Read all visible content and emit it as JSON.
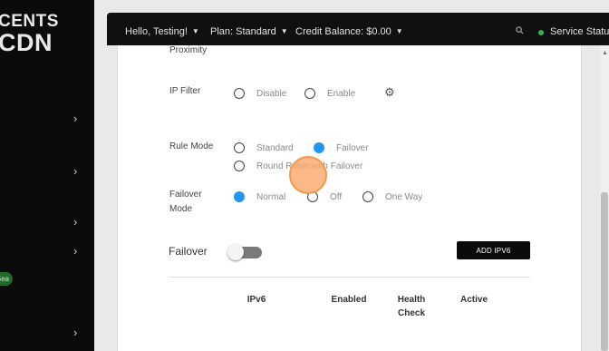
{
  "brand": {
    "line1": "CENTS",
    "line2": "CDN"
  },
  "sidebar": {
    "badge": "Sea"
  },
  "topbar": {
    "greeting": "Hello, Testing!",
    "plan": "Plan: Standard",
    "credit": "Credit Balance: $0.00",
    "service_status": "Service Status"
  },
  "form": {
    "proximity_label": "Proximity",
    "ip_filter": {
      "label": "IP Filter",
      "options": [
        "Disable",
        "Enable"
      ],
      "selected": ""
    },
    "rule_mode": {
      "label": "Rule Mode",
      "options": [
        "Standard",
        "Failover",
        "Round Robin with Failover"
      ],
      "selected": "Failover"
    },
    "failover_mode": {
      "label_line1": "Failover",
      "label_line2": "Mode",
      "options": [
        "Normal",
        "Off",
        "One Way"
      ],
      "selected": "Normal"
    }
  },
  "failover_section": {
    "title": "Failover",
    "toggle_on": false,
    "add_button": "ADD IPV6",
    "table_headers": [
      "IPv6",
      "Enabled",
      "Health Check",
      "Active"
    ]
  },
  "colors": {
    "accent": "#2196f3",
    "dark": "#0b0b0b",
    "status_dot": "#37b24d",
    "cursor": "#f19a4d"
  },
  "icons": [
    "gear-icon",
    "search-icon",
    "chevron-right-icon",
    "chevron-down-icon"
  ]
}
